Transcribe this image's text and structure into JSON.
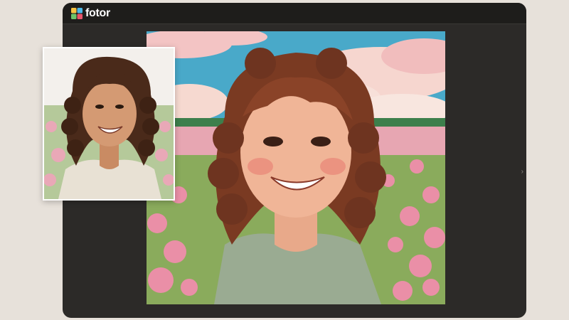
{
  "app": {
    "logo_text": "fotor",
    "logo_icon": "fotor-logo-icon"
  },
  "colors": {
    "window_bg": "#2c2a28",
    "topbar_bg": "#1e1d1b",
    "page_bg": "#e7e1da"
  },
  "images": {
    "source": "source-photo",
    "result": "anime-portrait-result"
  }
}
